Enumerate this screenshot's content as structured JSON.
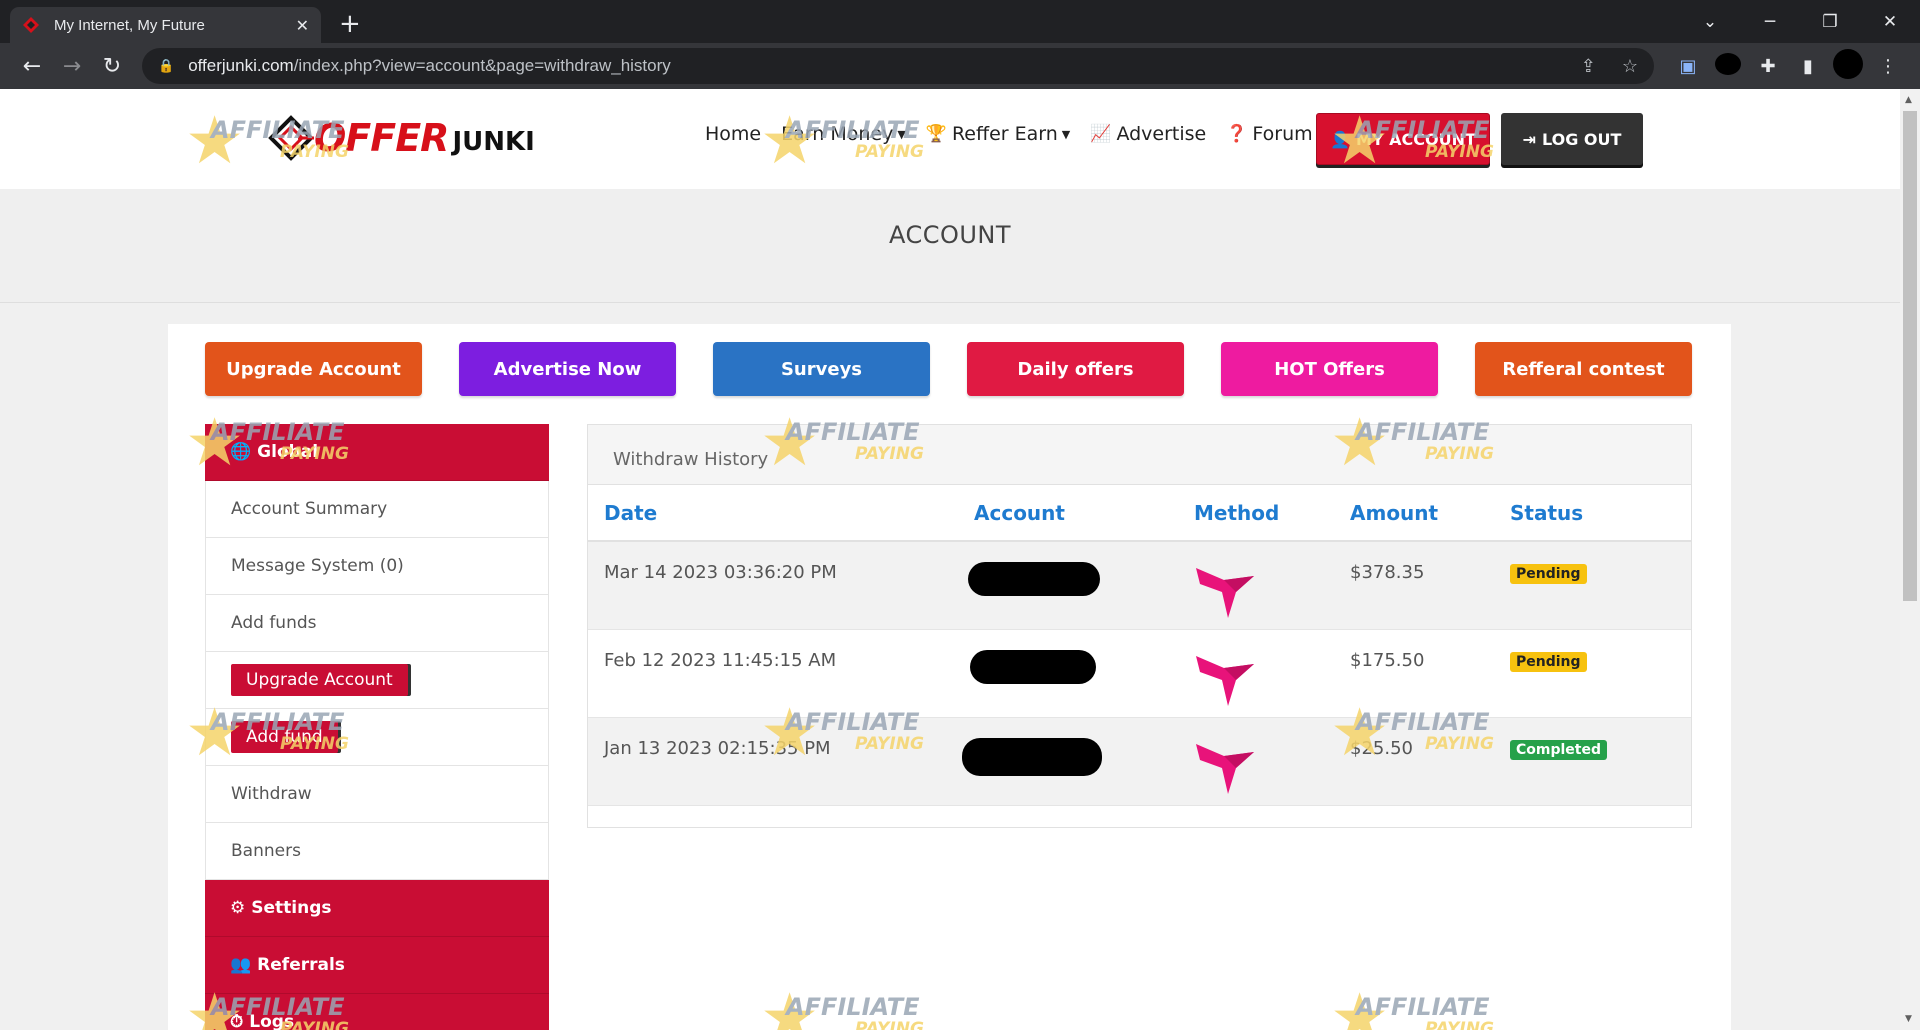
{
  "browser": {
    "tab_title": "My Internet, My Future",
    "url_domain": "offerjunki.com",
    "url_path": "/index.php?view=account&page=withdraw_history"
  },
  "site": {
    "logo_offer": "OFFER",
    "logo_junki": "JUNKI",
    "nav": [
      {
        "label": "Home"
      },
      {
        "label": "Earn Money"
      },
      {
        "label": "Reffer Earn"
      },
      {
        "label": "Advertise"
      },
      {
        "label": "Forum"
      }
    ],
    "my_account": "MY ACCOUNT",
    "log_out": "LOG OUT"
  },
  "page": {
    "title": "ACCOUNT"
  },
  "actions": [
    {
      "label": "Upgrade Account",
      "color": "#e2541b"
    },
    {
      "label": "Advertise Now",
      "color": "#7d1ee0"
    },
    {
      "label": "Surveys",
      "color": "#2a73c4"
    },
    {
      "label": "Daily offers",
      "color": "#e01a43"
    },
    {
      "label": "HOT Offers",
      "color": "#ee1ba0"
    },
    {
      "label": "Refferal contest",
      "color": "#e2541b"
    }
  ],
  "sidebar": {
    "global": "Global",
    "items": [
      {
        "label": "Account Summary"
      },
      {
        "label": "Message System (0)"
      },
      {
        "label": "Add funds"
      },
      {
        "label": "Upgrade Account"
      },
      {
        "label": "Add fund"
      },
      {
        "label": "Withdraw"
      },
      {
        "label": "Banners"
      }
    ],
    "settings": "Settings",
    "referrals": "Referrals",
    "logs": "Logs"
  },
  "history": {
    "title": "Withdraw History",
    "headers": [
      "Date",
      "Account",
      "Method",
      "Amount",
      "Status"
    ],
    "rows": [
      {
        "date": "Mar 14 2023 03:36:20 PM",
        "amount": "$378.35",
        "status": "Pending"
      },
      {
        "date": "Feb 12 2023 11:45:15 AM",
        "amount": "$175.50",
        "status": "Pending"
      },
      {
        "date": "Jan 13 2023 02:15:35 PM",
        "amount": "$25.50",
        "status": "Completed"
      }
    ]
  },
  "watermark": {
    "line1": "AFFILIATE",
    "line2": "PAYING"
  }
}
